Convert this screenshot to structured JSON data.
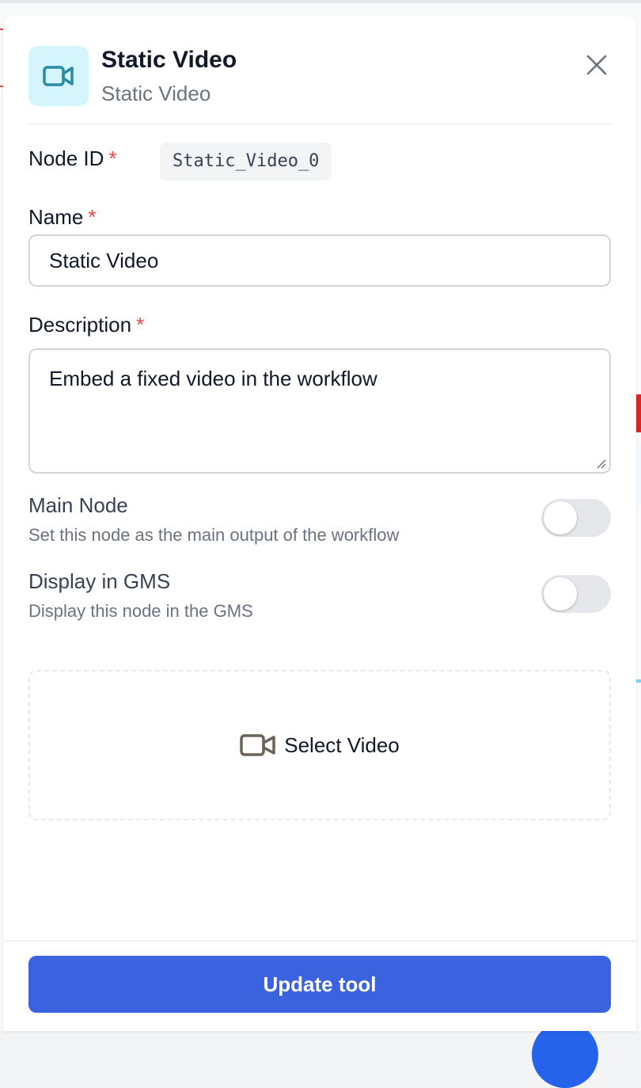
{
  "header": {
    "title": "Static Video",
    "subtitle": "Static Video"
  },
  "fields": {
    "node_id": {
      "label": "Node ID",
      "required_mark": "*",
      "value": "Static_Video_0"
    },
    "name": {
      "label": "Name",
      "required_mark": "*",
      "value": "Static Video"
    },
    "description": {
      "label": "Description",
      "required_mark": "*",
      "value": "Embed a fixed video in the workflow"
    }
  },
  "toggles": {
    "main_node": {
      "title": "Main Node",
      "description": "Set this node as the main output of the workflow",
      "enabled": false
    },
    "display_gms": {
      "title": "Display in GMS",
      "description": "Display this node in the GMS",
      "enabled": false
    }
  },
  "video_picker": {
    "label": "Select Video",
    "icon": "video-camera-icon"
  },
  "footer": {
    "update_label": "Update tool"
  },
  "colors": {
    "accent": "#3b63e0",
    "icon_bg": "#d4f5fb",
    "icon_teal": "#2a8aa0",
    "required": "#ef4444"
  }
}
